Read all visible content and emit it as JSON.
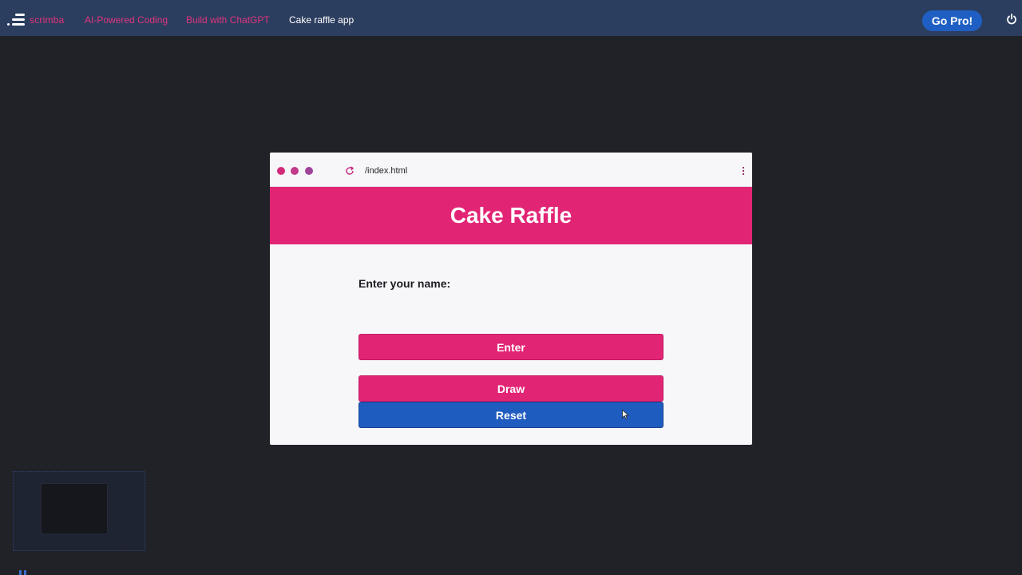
{
  "topbar": {
    "brand": "scrimba",
    "breadcrumbs": [
      {
        "label": "AI-Powered Coding"
      },
      {
        "label": "Build with ChatGPT"
      },
      {
        "label": "Cake raffle app"
      }
    ],
    "go_pro_label": "Go Pro!",
    "icons": {
      "logo": "scrimba-logo-icon",
      "power": "power-icon"
    }
  },
  "preview": {
    "url": "/index.html",
    "icons": {
      "reload": "reload-icon",
      "menu": "kebab-menu-icon"
    },
    "app": {
      "title": "Cake Raffle",
      "name_label": "Enter your name:",
      "name_value": "",
      "buttons": {
        "enter": "Enter",
        "draw": "Draw",
        "reset": "Reset"
      }
    }
  },
  "colors": {
    "accent_pink": "#e22475",
    "accent_blue": "#1f5cc0",
    "topbar": "#2c3e5f",
    "background": "#212227"
  }
}
